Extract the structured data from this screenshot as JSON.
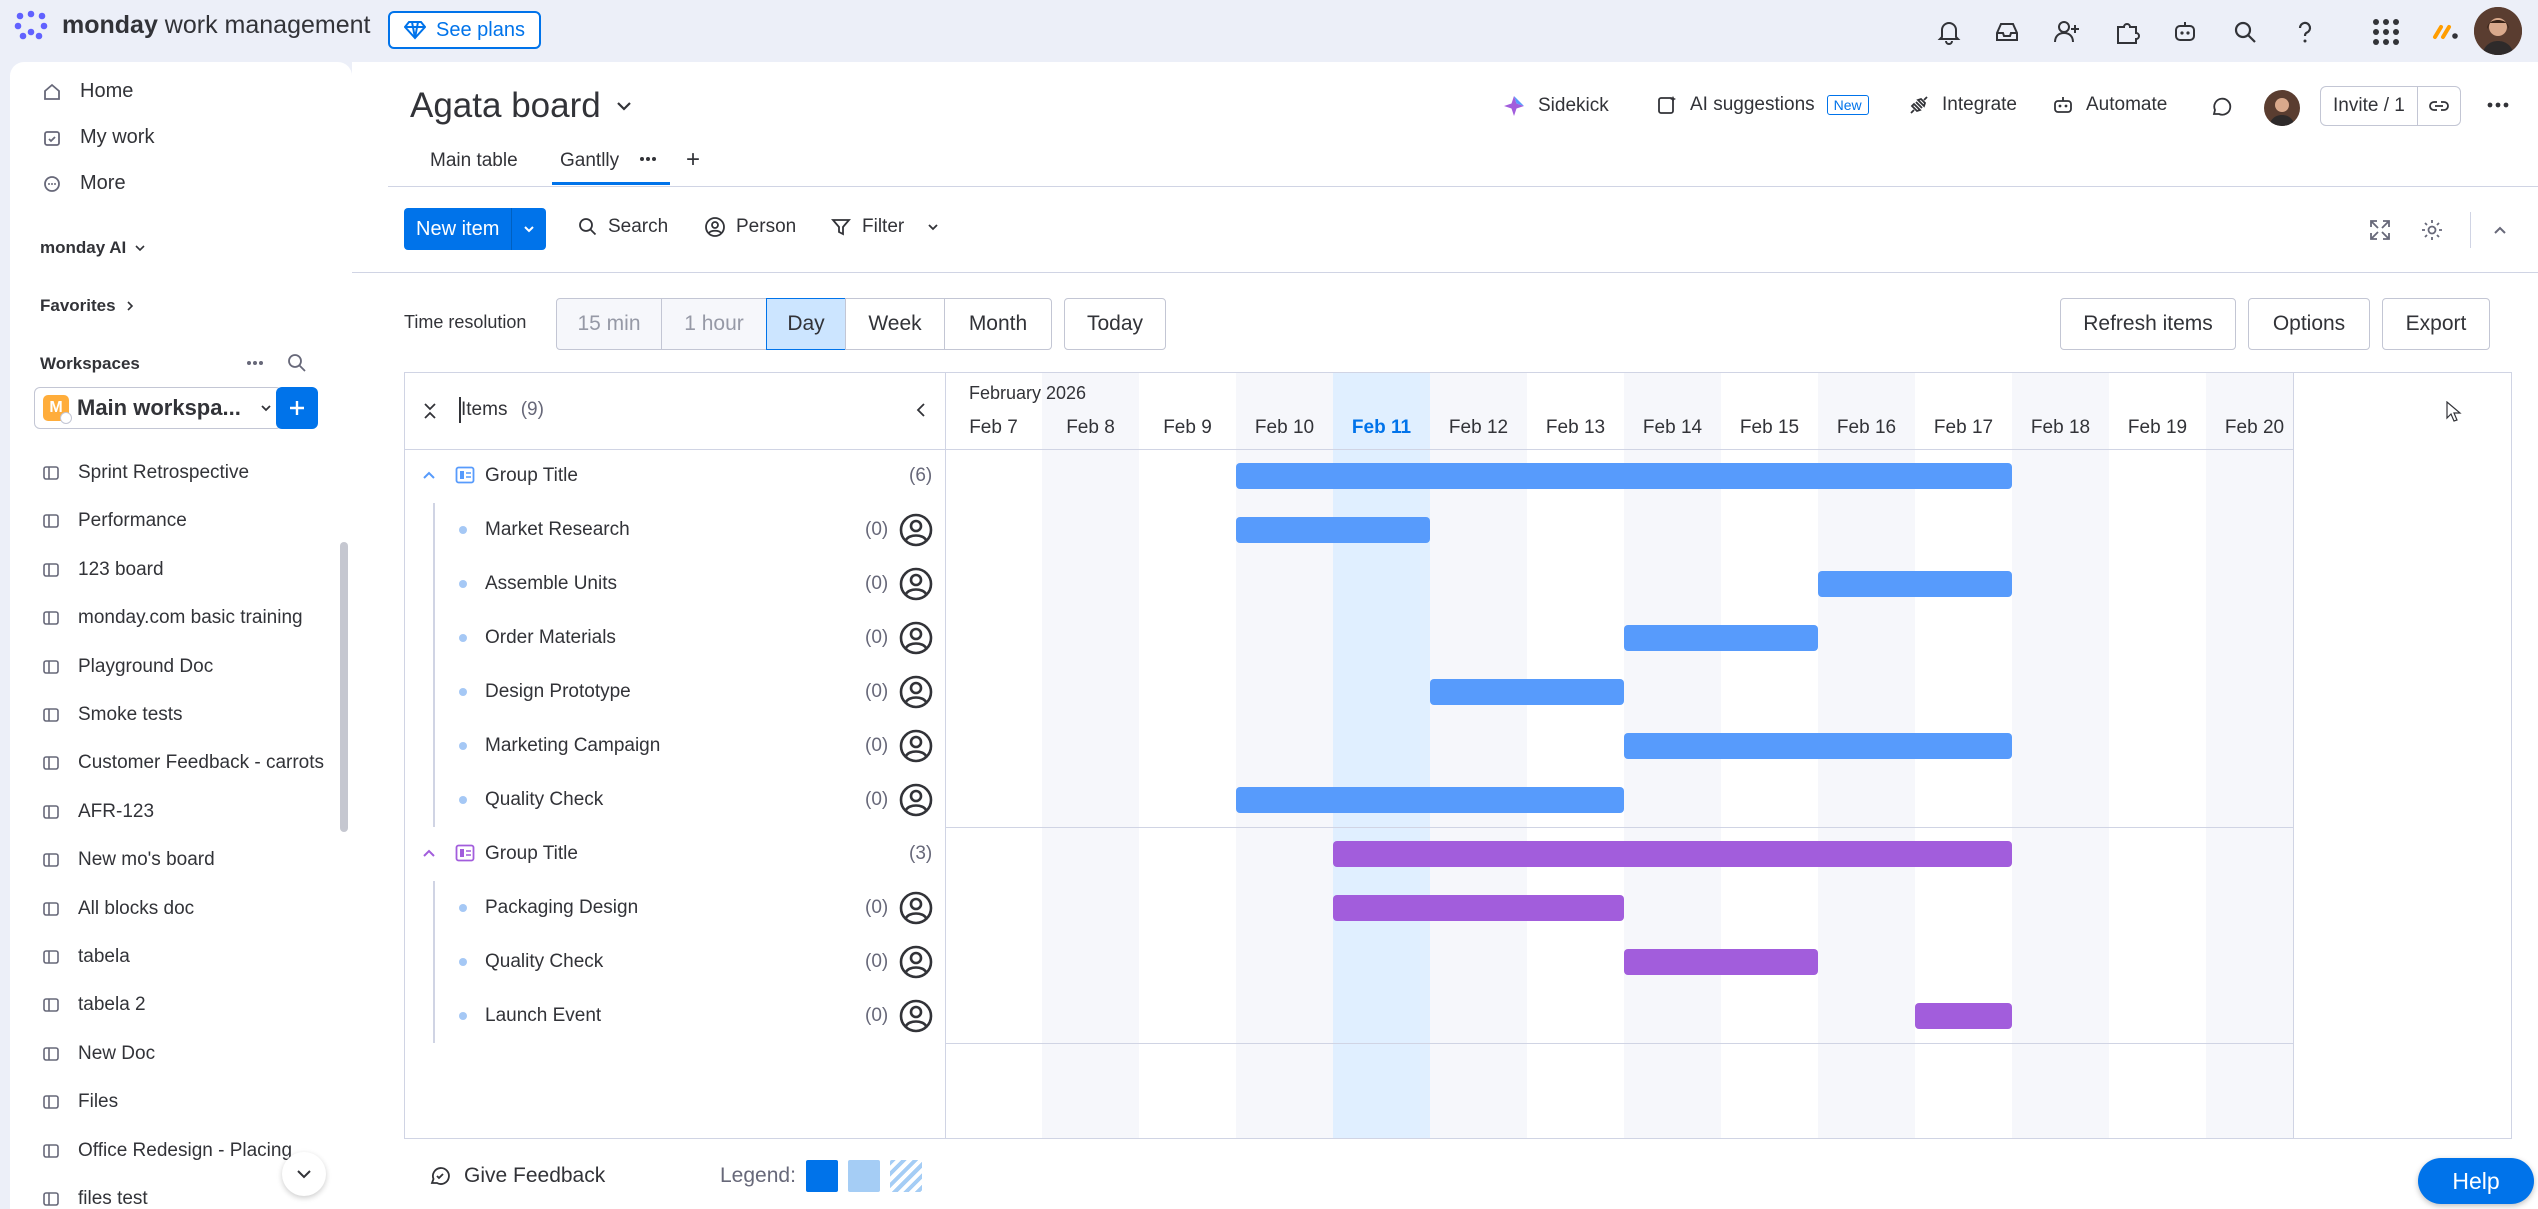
{
  "app": {
    "brand_bold": "monday",
    "brand_rest": " work management",
    "see_plans": "See plans"
  },
  "sidebar": {
    "nav": [
      "Home",
      "My work",
      "More"
    ],
    "monday_ai": "monday AI",
    "favorites": "Favorites",
    "workspaces": "Workspaces",
    "workspace_name": "Main workspa...",
    "workspace_initial": "M",
    "boards": [
      "Sprint Retrospective",
      "Performance",
      "123 board",
      "monday.com basic training",
      "Playground Doc",
      "Smoke tests",
      "Customer Feedback - carrots",
      "AFR-123",
      "New mo's board",
      "All blocks doc",
      "tabela",
      "tabela 2",
      "New Doc",
      "Files",
      "Office Redesign - Placing",
      "files test"
    ]
  },
  "board": {
    "title": "Agata board",
    "tabs": [
      "Main table",
      "Gantlly"
    ],
    "add_tab": "+",
    "actions": {
      "sidekick": "Sidekick",
      "ai_suggestions": "AI suggestions",
      "new_tag": "New",
      "integrate": "Integrate",
      "automate": "Automate",
      "invite": "Invite / 1"
    }
  },
  "toolbar": {
    "new_item": "New item",
    "search": "Search",
    "person": "Person",
    "filter": "Filter"
  },
  "gantt": {
    "time_resolution_label": "Time resolution",
    "resolutions": [
      "15 min",
      "1 hour",
      "Day",
      "Week",
      "Month"
    ],
    "active_resolution": "Day",
    "today": "Today",
    "refresh": "Refresh items",
    "options": "Options",
    "export": "Export",
    "items_label": "Items",
    "items_count": "(9)",
    "month": "February 2026",
    "days": [
      "Feb 7",
      "Feb 8",
      "Feb 9",
      "Feb 10",
      "Feb 11",
      "Feb 12",
      "Feb 13",
      "Feb 14",
      "Feb 15",
      "Feb 16",
      "Feb 17",
      "Feb 18",
      "Feb 19",
      "Feb 20"
    ],
    "today_day": "Feb 11",
    "groups": [
      {
        "title": "Group Title",
        "count": "(6)",
        "color": "#579bfc",
        "span": [
          "Feb 10",
          "Feb 17"
        ],
        "items": [
          {
            "name": "Market Research",
            "count": "(0)",
            "start": "Feb 10",
            "end": "Feb 11"
          },
          {
            "name": "Assemble Units",
            "count": "(0)",
            "start": "Feb 16",
            "end": "Feb 17"
          },
          {
            "name": "Order Materials",
            "count": "(0)",
            "start": "Feb 14",
            "end": "Feb 15"
          },
          {
            "name": "Design Prototype",
            "count": "(0)",
            "start": "Feb 12",
            "end": "Feb 13"
          },
          {
            "name": "Marketing Campaign",
            "count": "(0)",
            "start": "Feb 14",
            "end": "Feb 17"
          },
          {
            "name": "Quality Check",
            "count": "(0)",
            "start": "Feb 10",
            "end": "Feb 13"
          }
        ]
      },
      {
        "title": "Group Title",
        "count": "(3)",
        "color": "#a25ddc",
        "span": [
          "Feb 11",
          "Feb 17"
        ],
        "items": [
          {
            "name": "Packaging Design",
            "count": "(0)",
            "start": "Feb 11",
            "end": "Feb 13"
          },
          {
            "name": "Quality Check",
            "count": "(0)",
            "start": "Feb 14",
            "end": "Feb 15"
          },
          {
            "name": "Launch Event",
            "count": "(0)",
            "start": "Feb 17",
            "end": "Feb 17"
          }
        ]
      }
    ],
    "feedback": "Give Feedback",
    "legend_label": "Legend:"
  },
  "help": "Help",
  "colors": {
    "accent": "#0073ea",
    "group1": "#579bfc",
    "group2": "#a25ddc"
  }
}
